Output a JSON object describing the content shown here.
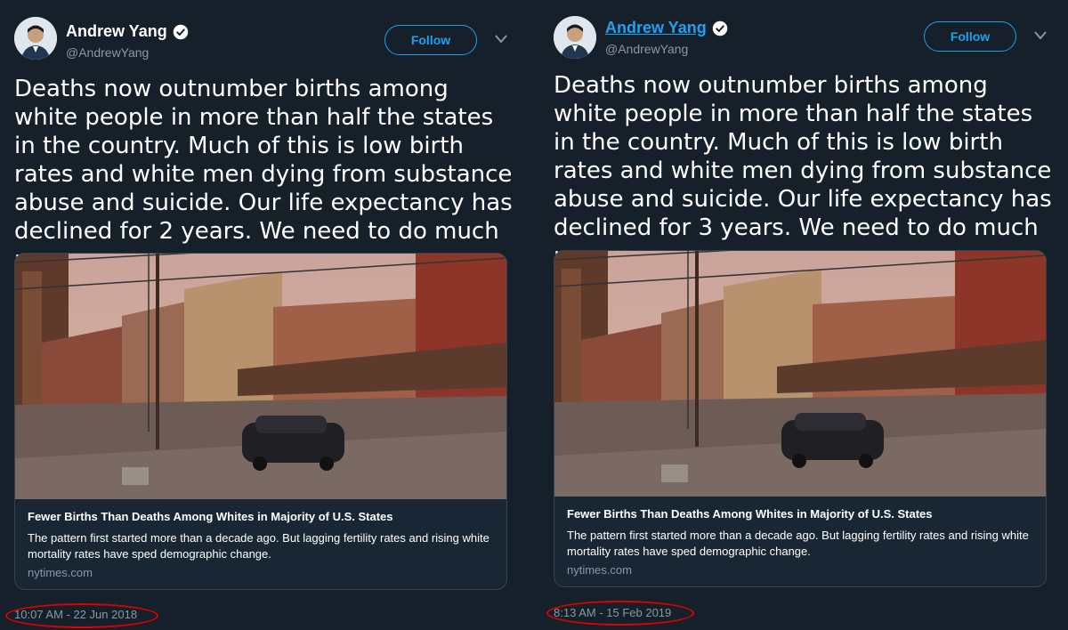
{
  "left_tweet": {
    "author_name": "Andrew Yang",
    "handle": "@AndrewYang",
    "follow_label": "Follow",
    "text": "Deaths now outnumber births among white people in more than half the states in the country. Much of this is low birth rates and white men dying from substance abuse and suicide. Our life expectancy has declined for 2 years. We need to do much more.",
    "card": {
      "title": "Fewer Births Than Deaths Among Whites in Majority of U.S. States",
      "description": "The pattern first started more than a decade ago. But lagging fertility rates and rising white mortality rates have sped demographic change.",
      "domain": "nytimes.com"
    },
    "timestamp": "10:07 AM - 22 Jun 2018"
  },
  "right_tweet": {
    "author_name": "Andrew Yang",
    "handle": "@AndrewYang",
    "follow_label": "Follow",
    "text": "Deaths now outnumber births among white people in more than half the states in the country. Much of this is low birth rates and white men dying from substance abuse and suicide. Our life expectancy has declined for 3 years. We need to do much more.",
    "card": {
      "title": "Fewer Births Than Deaths Among Whites in Majority of U.S. States",
      "description": "The pattern first started more than a decade ago. But lagging fertility rates and rising white mortality rates have sped demographic change.",
      "domain": "nytimes.com"
    },
    "timestamp": "8:13 AM - 15 Feb 2019"
  },
  "colors": {
    "background": "#15202b",
    "accent": "#1da1f2",
    "highlight_ring": "#e00000"
  },
  "icons": [
    "verified-badge-icon",
    "chevron-down-icon"
  ]
}
